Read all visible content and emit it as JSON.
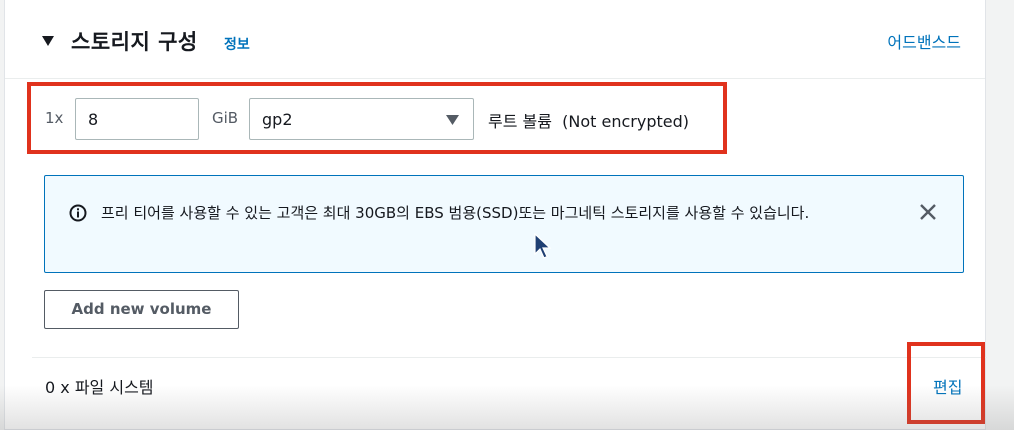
{
  "section": {
    "title": "스토리지 구성",
    "info_link": "정보",
    "advanced_link": "어드밴스드"
  },
  "volume": {
    "count_label": "1x",
    "size_value": "8",
    "size_unit": "GiB",
    "type_value": "gp2",
    "description": "루트 볼륨  (Not encrypted)"
  },
  "alert": {
    "icon": "info-icon",
    "text": "프리 티어를 사용할 수 있는 고객은 최대 30GB의 EBS 범용(SSD)또는 마그네틱 스토리지를 사용할 수 있습니다."
  },
  "buttons": {
    "add_volume": "Add new volume"
  },
  "filesystem": {
    "label": "0 x 파일 시스템",
    "edit_link": "편집"
  },
  "colors": {
    "link": "#0073bb",
    "highlight": "#e0321d",
    "alert_border": "#0073bb",
    "alert_bg": "#f1faff"
  }
}
